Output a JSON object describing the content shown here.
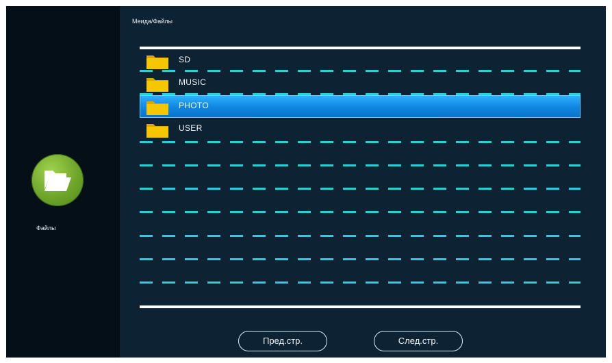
{
  "breadcrumb": "Меида/Файлы",
  "app": {
    "label": "Файлы",
    "icon": "folder-icon"
  },
  "list": {
    "items": [
      {
        "label": "SD",
        "icon": "folder-icon",
        "selected": false
      },
      {
        "label": "MUSIC",
        "icon": "folder-icon",
        "selected": false
      },
      {
        "label": "PHOTO",
        "icon": "folder-icon",
        "selected": true
      },
      {
        "label": "USER",
        "icon": "folder-icon",
        "selected": false
      }
    ]
  },
  "buttons": {
    "prev": "Пред.стр.",
    "next": "След.стр."
  },
  "colors": {
    "background": "#0d2233",
    "sidebar": "#050f18",
    "divider": "#27d0d9",
    "selection": "#1a94ee",
    "folder": "#f6c700",
    "app_icon": "#6ea52a"
  }
}
